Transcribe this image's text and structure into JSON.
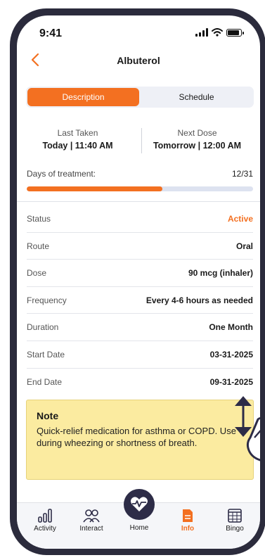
{
  "status_bar": {
    "time": "9:41"
  },
  "header": {
    "title": "Albuterol"
  },
  "segments": {
    "description": "Description",
    "schedule": "Schedule",
    "selected": "Description"
  },
  "doses": {
    "last_taken_label": "Last Taken",
    "last_taken_value": "Today | 11:40 AM",
    "next_dose_label": "Next Dose",
    "next_dose_value": "Tomorrow | 12:00 AM"
  },
  "treatment": {
    "label": "Days of treatment:",
    "count": "12/31",
    "progress_fraction": 0.6
  },
  "details": [
    {
      "label": "Status",
      "value": "Active"
    },
    {
      "label": "Route",
      "value": "Oral"
    },
    {
      "label": "Dose",
      "value": "90 mcg (inhaler)"
    },
    {
      "label": "Frequency",
      "value": "Every 4-6 hours as needed"
    },
    {
      "label": "Duration",
      "value": "One Month"
    },
    {
      "label": "Start Date",
      "value": "03-31-2025"
    },
    {
      "label": "End Date",
      "value": "09-31-2025"
    }
  ],
  "note": {
    "title": "Note",
    "text": "Quick-relief medication for asthma or COPD. Use during wheezing or shortness of breath."
  },
  "tabs": {
    "activity": "Activity",
    "interact": "Interact",
    "home": "Home",
    "info": "Info",
    "bingo": "Bingo",
    "selected": "Info"
  },
  "colors": {
    "accent": "#f37021",
    "dark": "#2d2c47",
    "note_bg": "#fbeba0"
  }
}
